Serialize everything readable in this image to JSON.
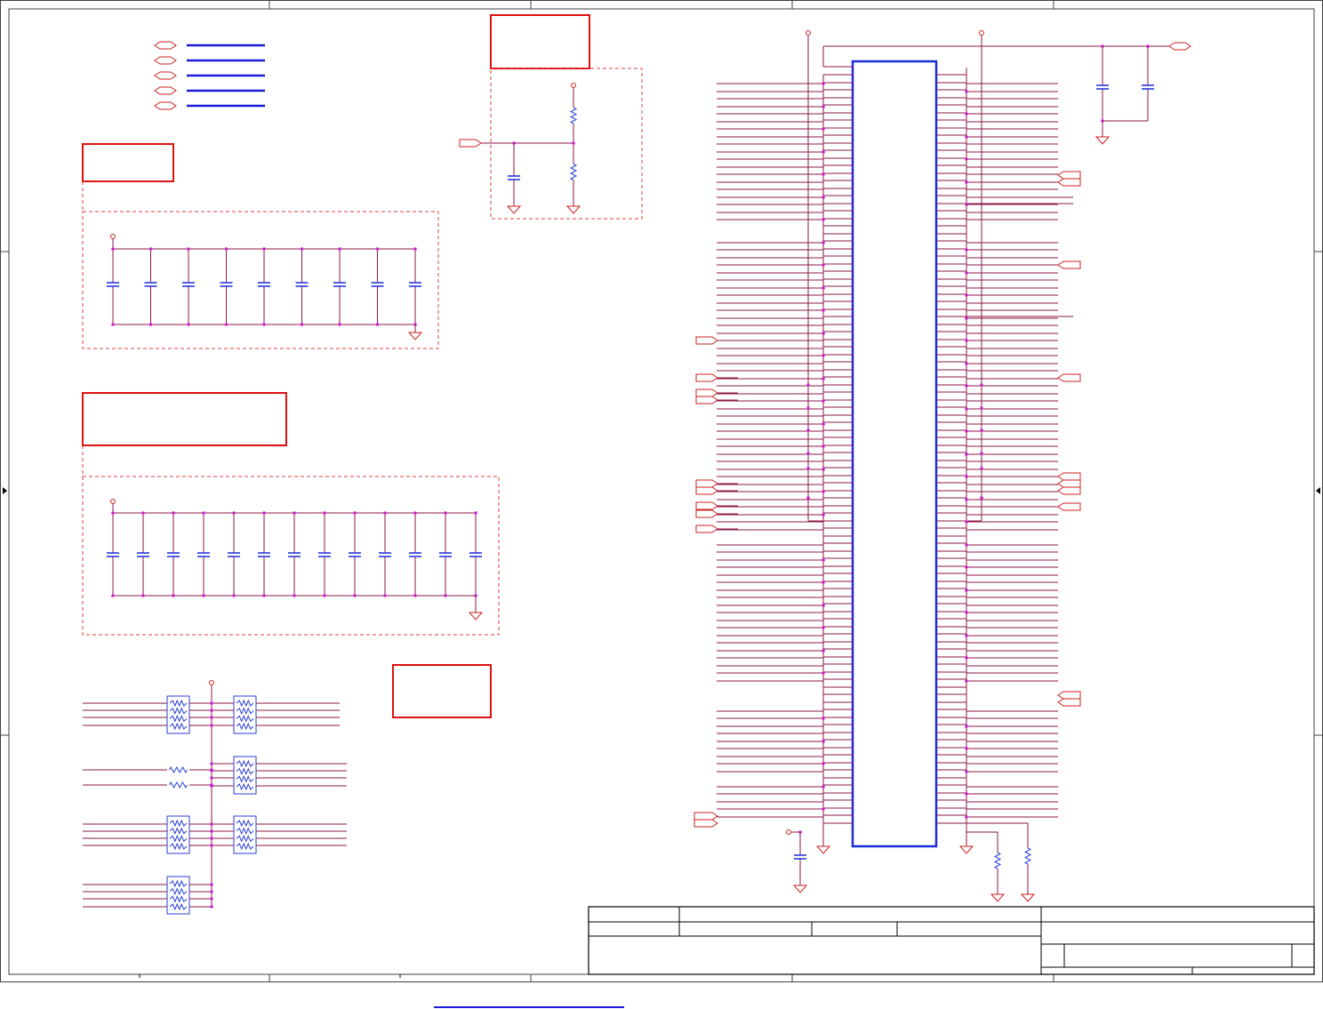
{
  "sheet": {
    "background": "#ffffff",
    "border_color": "#404040"
  },
  "colors": {
    "wire": "#8b1a4a",
    "junction": "#cc22cc",
    "symbol_red": "#cc2222",
    "ic_outline": "#1c2bd9",
    "resistor": "#2a3fd6",
    "bus_blue": "#1a1ad9",
    "box_border": "#e01010",
    "dashed_group": "#e04040",
    "title_block": "#000000"
  },
  "icons": {
    "capacitor": "capacitor-icon",
    "resistor": "resistor-icon",
    "ground": "ground-icon",
    "power": "power-pin-icon",
    "port": "net-port-icon",
    "resistor_network": "resistor-network-icon",
    "ic": "ic-package-icon"
  },
  "title_block": {
    "cells": []
  }
}
